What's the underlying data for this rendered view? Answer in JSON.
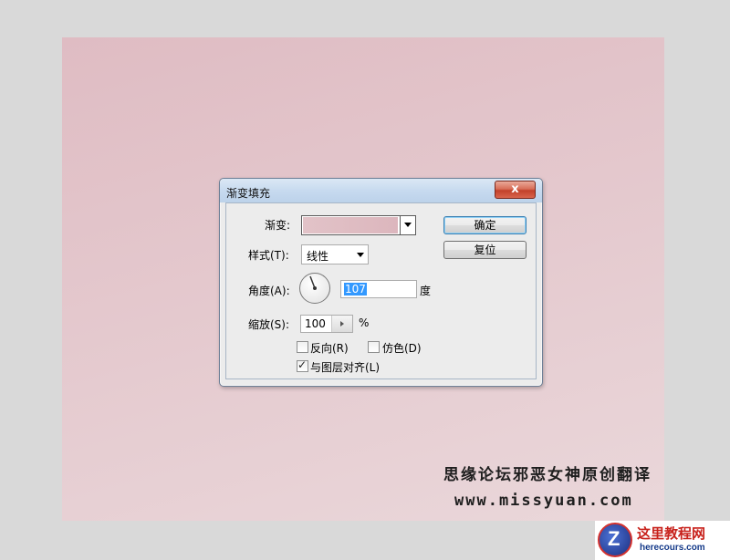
{
  "dialog": {
    "title": "渐变填充",
    "close_label": "x",
    "gradient_label": "渐变:",
    "gradient_colors": [
      "#e2c3c8",
      "#dcb6bd"
    ],
    "style_label": "样式(T):",
    "style_value": "线性",
    "angle_label": "角度(A):",
    "angle_value": "107",
    "angle_unit": "度",
    "scale_label": "缩放(S):",
    "scale_value": "100",
    "scale_unit": "%",
    "reverse_label": "反向(R)",
    "reverse_checked": false,
    "dither_label": "仿色(D)",
    "dither_checked": false,
    "align_label": "与图层对齐(L)",
    "align_checked": true,
    "ok_label": "确定",
    "reset_label": "复位"
  },
  "canvas": {
    "colors": [
      "#dfbcc3",
      "#ead7da"
    ]
  },
  "watermark": {
    "site_name": "思缘论坛邪恶女神原创翻译",
    "site_url": "www.missyuan.com"
  },
  "logo": {
    "letter": "Z",
    "name": "这里教程网",
    "url": "herecours.com"
  }
}
